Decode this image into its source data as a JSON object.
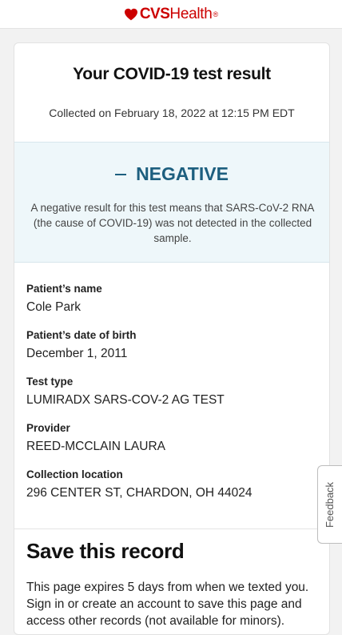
{
  "brand": {
    "name_bold": "CVS",
    "name_regular": "Health",
    "trademark": "®",
    "color": "#cc0000",
    "icon": "heart-icon"
  },
  "result_card": {
    "title": "Your COVID-19 test result",
    "collected": "Collected on February 18, 2022 at 12:15 PM EDT",
    "result": {
      "status": "NEGATIVE",
      "status_color": "#1d5f7f",
      "icon": "minus-icon",
      "description": "A negative result for this test means that SARS-CoV-2 RNA (the cause of COVID-19) was not detected in the collected sample."
    },
    "fields": [
      {
        "label": "Patient’s name",
        "value": "Cole Park"
      },
      {
        "label": "Patient’s date of birth",
        "value": "December 1, 2011"
      },
      {
        "label": "Test type",
        "value": "LUMIRADX SARS-COV-2 AG TEST"
      },
      {
        "label": "Provider",
        "value": "REED-MCCLAIN LAURA"
      },
      {
        "label": "Collection location",
        "value": "296 CENTER ST, CHARDON, OH 44024"
      }
    ]
  },
  "save_section": {
    "title": "Save this record",
    "text": "This page expires 5 days from when we texted you. Sign in or create an account to save this page and access other records (not available for minors)."
  },
  "feedback_tab": {
    "label": "Feedback"
  }
}
